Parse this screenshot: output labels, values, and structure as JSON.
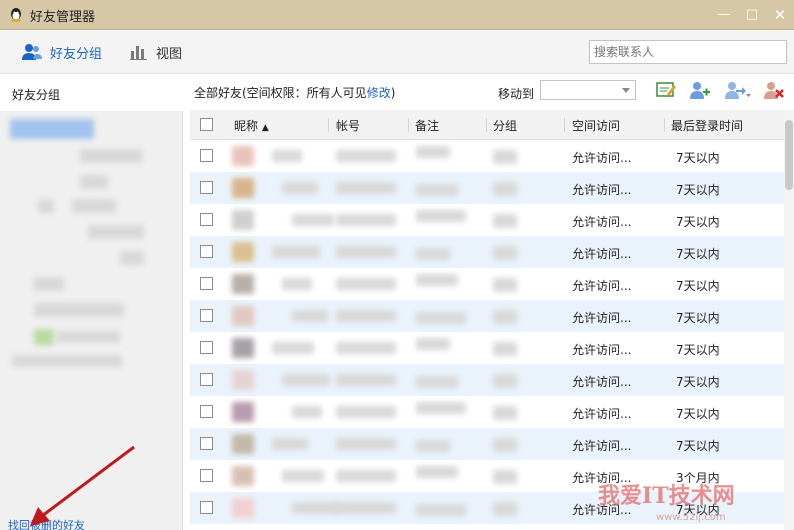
{
  "window": {
    "title": "好友管理器",
    "minimize": "—",
    "maximize": "□",
    "close": "✕"
  },
  "toolbar": {
    "groups_label": "好友分组",
    "view_label": "视图",
    "search_placeholder": "搜索联系人"
  },
  "sidebar": {
    "header": "好友分组",
    "footer_link": "找回被删的好友"
  },
  "main": {
    "info_prefix": "全部好友(空间权限：所有人可见",
    "info_link": "修改",
    "info_suffix": ")",
    "move_to_label": "移动到"
  },
  "table": {
    "columns": [
      "昵称",
      "帐号",
      "备注",
      "分组",
      "空间访问",
      "最后登录时间"
    ],
    "sort_indicator": "▲",
    "rows": [
      {
        "access": "允许访问...",
        "last_login": "7天以内"
      },
      {
        "access": "允许访问...",
        "last_login": "7天以内"
      },
      {
        "access": "允许访问...",
        "last_login": "7天以内"
      },
      {
        "access": "允许访问...",
        "last_login": "7天以内"
      },
      {
        "access": "允许访问...",
        "last_login": "7天以内"
      },
      {
        "access": "允许访问...",
        "last_login": "7天以内"
      },
      {
        "access": "允许访问...",
        "last_login": "7天以内"
      },
      {
        "access": "允许访问...",
        "last_login": "7天以内"
      },
      {
        "access": "允许访问...",
        "last_login": "7天以内"
      },
      {
        "access": "允许访问...",
        "last_login": "7天以内"
      },
      {
        "access": "允许访问...",
        "last_login": "3个月内"
      },
      {
        "access": "允许访问...",
        "last_login": "7天以内"
      }
    ]
  },
  "watermark": {
    "text": "我爱IT技术网",
    "sub": "www.52ij.com"
  },
  "colors": {
    "titlebar": "#d6c8a6",
    "accent": "#1a64c8",
    "row_alt": "#eaf3fb",
    "arrow": "#c0191c"
  }
}
